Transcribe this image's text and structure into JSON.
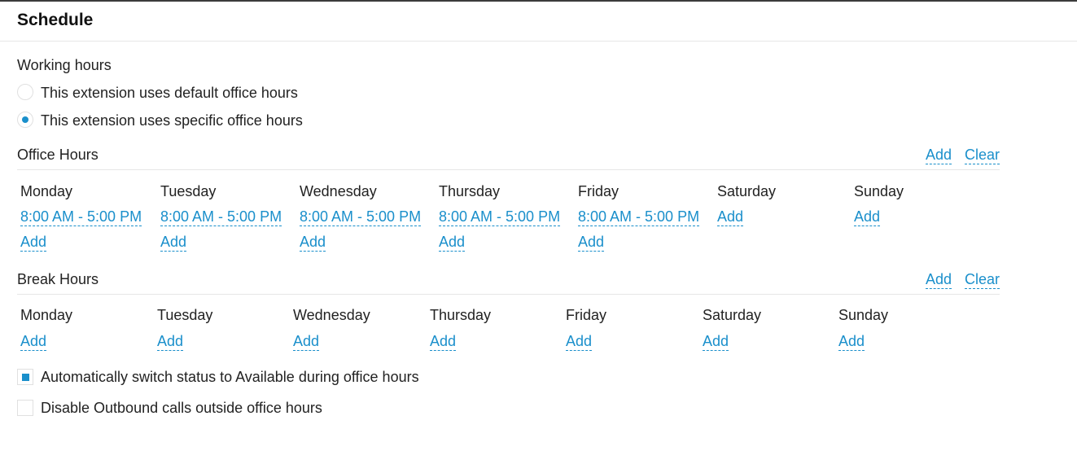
{
  "section_title": "Schedule",
  "working_hours": {
    "label": "Working hours",
    "options": [
      {
        "label": "This extension uses default office hours",
        "selected": false
      },
      {
        "label": "This extension uses specific office hours",
        "selected": true
      }
    ]
  },
  "office_hours": {
    "title": "Office Hours",
    "add_label": "Add",
    "clear_label": "Clear",
    "days": [
      {
        "day": "Monday",
        "slot": "8:00 AM - 5:00 PM",
        "add": "Add"
      },
      {
        "day": "Tuesday",
        "slot": "8:00 AM - 5:00 PM",
        "add": "Add"
      },
      {
        "day": "Wednesday",
        "slot": "8:00 AM - 5:00 PM",
        "add": "Add"
      },
      {
        "day": "Thursday",
        "slot": "8:00 AM - 5:00 PM",
        "add": "Add"
      },
      {
        "day": "Friday",
        "slot": "8:00 AM - 5:00 PM",
        "add": "Add"
      },
      {
        "day": "Saturday",
        "add": "Add"
      },
      {
        "day": "Sunday",
        "add": "Add"
      }
    ]
  },
  "break_hours": {
    "title": "Break Hours",
    "add_label": "Add",
    "clear_label": "Clear",
    "days": [
      {
        "day": "Monday",
        "add": "Add"
      },
      {
        "day": "Tuesday",
        "add": "Add"
      },
      {
        "day": "Wednesday",
        "add": "Add"
      },
      {
        "day": "Thursday",
        "add": "Add"
      },
      {
        "day": "Friday",
        "add": "Add"
      },
      {
        "day": "Saturday",
        "add": "Add"
      },
      {
        "day": "Sunday",
        "add": "Add"
      }
    ]
  },
  "options": {
    "auto_switch": {
      "label": "Automatically switch status to Available during office hours",
      "checked": true
    },
    "disable_outbound": {
      "label": "Disable Outbound calls outside office hours",
      "checked": false
    }
  },
  "colors": {
    "accent": "#1a8fcb",
    "text": "#222222",
    "divider": "#e6e6e6"
  }
}
